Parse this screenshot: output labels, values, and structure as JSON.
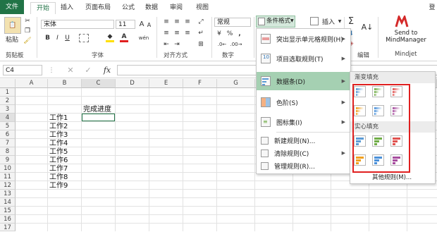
{
  "tabs": [
    "文件",
    "开始",
    "插入",
    "页面布局",
    "公式",
    "数据",
    "审阅",
    "视图"
  ],
  "user_initial": "登",
  "clipboard": {
    "paste": "粘贴",
    "label": "剪贴板"
  },
  "font": {
    "name": "宋体",
    "size": "11",
    "label": "字体",
    "bold": "B",
    "italic": "I",
    "underline": "U",
    "wen": "wén",
    "grow": "A",
    "shrink": "A"
  },
  "align": {
    "label": "对齐方式"
  },
  "number": {
    "format": "常规",
    "label": "数字",
    "percent": "%",
    "comma": ",",
    "currency": "¥"
  },
  "styles": {
    "cond_format": "条件格式"
  },
  "cells": {
    "insert": "插入"
  },
  "editing": {
    "label": "编辑",
    "sigma": "Σ"
  },
  "mindjet": {
    "line1": "Send to",
    "line2": "MindManager",
    "label": "Mindjet"
  },
  "formula": {
    "namebox": "C4",
    "fx": "fx",
    "value": ""
  },
  "columns": [
    "A",
    "B",
    "C",
    "D",
    "E",
    "F",
    "G"
  ],
  "rows": [
    "1",
    "2",
    "3",
    "4",
    "5",
    "6",
    "7",
    "8",
    "9",
    "10",
    "11",
    "12",
    "13",
    "14",
    "15",
    "16",
    "17"
  ],
  "cell_values": {
    "C3": "完成进度",
    "B4": "工作1",
    "B5": "工作2",
    "B6": "工作3",
    "B7": "工作4",
    "B8": "工作5",
    "B9": "工作6",
    "B10": "工作7",
    "B11": "工作8",
    "B12": "工作9"
  },
  "cf_menu": [
    {
      "label": "突出显示单元格规则(H)",
      "arrow": "▶"
    },
    {
      "label": "项目选取规则(T)",
      "arrow": "▶"
    },
    {
      "label": "数据条(D)",
      "arrow": "▶",
      "selected": true
    },
    {
      "label": "色阶(S)",
      "arrow": "▶"
    },
    {
      "label": "图标集(I)",
      "arrow": "▶"
    },
    {
      "label": "新建规则(N)..."
    },
    {
      "label": "清除规则(C)",
      "arrow": "▶"
    },
    {
      "label": "管理规则(R)..."
    }
  ],
  "databar_menu": {
    "gradient": "渐变填充",
    "solid": "实心填充",
    "more": "其他规则(M)..."
  },
  "databar_colors": [
    "#5b9bd5",
    "#70ad47",
    "#e0524f",
    "#f0a020",
    "#4a90d9",
    "#a64d9e"
  ],
  "highlight_color": "#e02020"
}
